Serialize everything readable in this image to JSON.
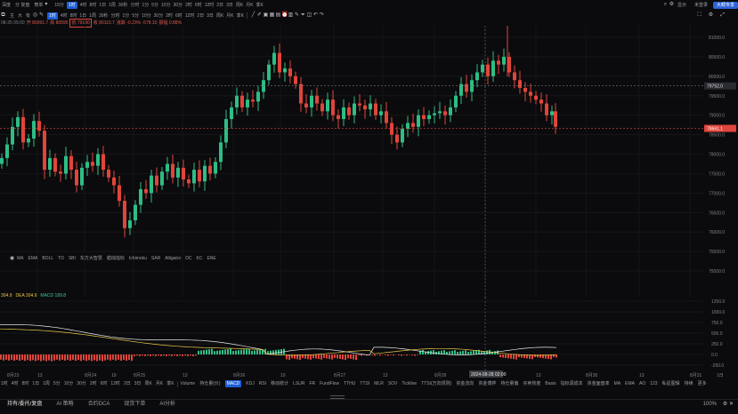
{
  "top_toolbar": {
    "left_label": "深度",
    "tab_label": "分 复盘",
    "mode_label": "筒单",
    "timeframes": [
      "15分",
      "1时",
      "4时",
      "8时",
      "1日",
      "1周",
      "30秒",
      "分时",
      "1分",
      "5分",
      "10分",
      "30分",
      "2时",
      "6时",
      "12时",
      "2日",
      "3日",
      "周K",
      "月K",
      "季K"
    ],
    "selected_timeframe": "1时",
    "right_items": [
      "显示",
      "未登录"
    ],
    "right_button": "大鳄专享"
  },
  "drawing_toolbar": {
    "labels": [
      "主",
      "大",
      "有"
    ],
    "selected": "1时",
    "timeframes": [
      "4时",
      "8时",
      "1日",
      "1周",
      "30秒",
      "分时",
      "1分",
      "5分",
      "10分",
      "30分",
      "2时",
      "6时",
      "12时",
      "2日",
      "3日",
      "周K",
      "月K",
      "季K"
    ]
  },
  "ohlc_bar": {
    "date": "08-25 05:00",
    "open": "80091.7",
    "high": "80595",
    "low": "79190",
    "close": "80110.7",
    "change": "-0.23%",
    "amplitude": "-578.10",
    "vol": "0.88%",
    "highlighted": "79190"
  },
  "price_markers": {
    "peak_label": "81320.0",
    "ref_price": "79752.0",
    "last_price": "78661.1",
    "crosshair_time": "2024-08-28 02:00"
  },
  "indicator_row": {
    "items": [
      "MA",
      "EMA",
      "BOLL",
      "TD",
      "SBI",
      "东方大智慧",
      "蜡烛指标",
      "Ichimoku",
      "SAR",
      "Alligator",
      "DC",
      "KC",
      "ENE"
    ]
  },
  "macd_legend": {
    "macd": "304.9",
    "dea": "DEA 304.9",
    "macd_val": "MACD 189.8"
  },
  "xaxis": {
    "labels": [
      "8月23",
      "13",
      "8月24",
      "19",
      "8月25",
      "13",
      "8月26",
      "19",
      "8月27",
      "13",
      "8月28",
      "8月29",
      "13",
      "8月30",
      "13",
      "8月31"
    ],
    "crosshair": "2024-08-28 02:00",
    "right_label": "1日"
  },
  "bottom_toolbar": {
    "timeframes": [
      "1时",
      "4时",
      "8时",
      "1日",
      "1周",
      "5分",
      "10分",
      "30分",
      "2时",
      "6时",
      "12时",
      "2日",
      "3日",
      "周K",
      "月K",
      "季K"
    ],
    "indicators": [
      "Volume",
      "持仓量(价)",
      "MACD",
      "KDJ",
      "RSI",
      "移动统计",
      "LSUR",
      "FR",
      "FundFlow",
      "TTHU",
      "TTSI",
      "MLR",
      "SOV",
      "Tickline",
      "TTSI(万向规则)",
      "资金流向",
      "资金博弈",
      "持仓量偏",
      "买卖热度",
      "Basis",
      "指标源成本",
      "资金面盘率",
      "MA",
      "EMA",
      "AO",
      "123",
      "私星图辑",
      "持续",
      "更多"
    ],
    "selected_indicator": "MACD"
  },
  "tabs_bar": {
    "tabs": [
      "持有/委托/复盘",
      "AI 策略",
      "合约DCA",
      "现货下单",
      "AI分析"
    ],
    "right": "100%"
  },
  "chart_data": {
    "type": "candlestick",
    "ylim": [
      75000,
      81500
    ],
    "y_ticks": [
      81000.0,
      80500.0,
      80000.0,
      79500.0,
      79000.0,
      78500.0,
      78000.0,
      77500.0,
      77000.0,
      76500.0,
      76000.0,
      75500.0,
      75000.0
    ],
    "macd_ylim": [
      -300,
      1300
    ],
    "macd_ticks": [
      1250.0,
      1000.0,
      750.0,
      500.0,
      250.0,
      0.0,
      -250.0
    ]
  }
}
